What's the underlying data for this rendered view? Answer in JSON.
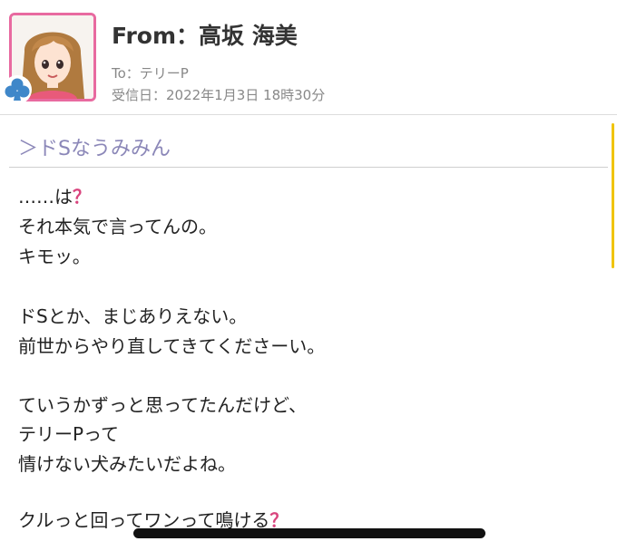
{
  "header": {
    "from": "From：高坂 海美",
    "to": "To：テリーP",
    "received": "受信日：2022年1月3日 18時30分"
  },
  "subject": "＞ドSなうみみん",
  "message_lines": [
    "……は",
    "？",
    "それ本気で言ってんの。",
    "キモッ。",
    "ドSとか、まじありえない。",
    "前世からやり直してきてくださーい。",
    "ていうかずっと思ってたんだけど、",
    "テリーPって",
    "情けない犬みたいだよね。",
    "クルっと回ってワンって鳴ける"
  ],
  "colors": {
    "avatar_border": "#e86aa0",
    "subject_text": "#8b87b8",
    "question_mark": "#d9457e",
    "scroll_indicator": "#f0c400",
    "club_badge": "#3f87c9"
  },
  "icons": {
    "avatar": "character-portrait",
    "badge": "club-suit-icon",
    "emphasis": "question-mark-icon"
  }
}
